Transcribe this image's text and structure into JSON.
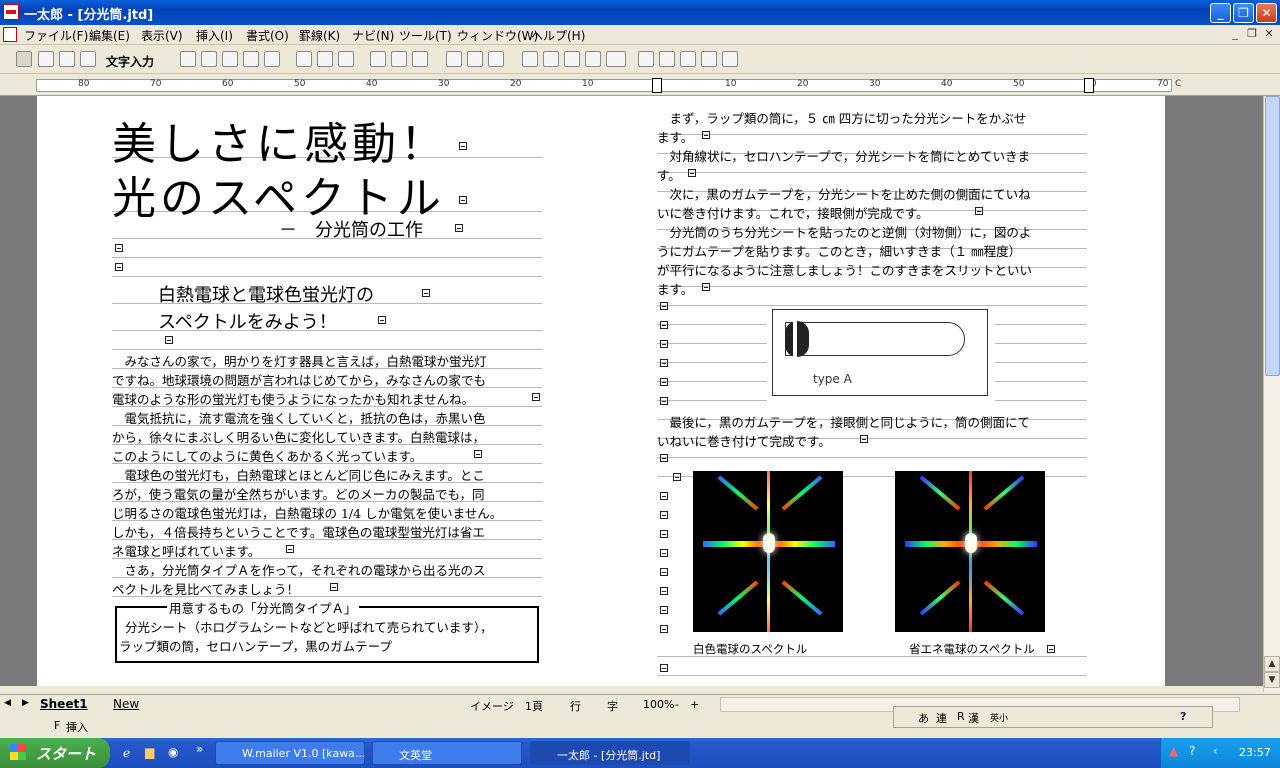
{
  "window": {
    "title": "一太郎 - [分光筒.jtd]"
  },
  "menu": {
    "items": [
      "ファイル(F)",
      "編集(E)",
      "表示(V)",
      "挿入(I)",
      "書式(O)",
      "罫線(K)",
      "ナビ(N)",
      "ツール(T)",
      "ウィンドウ(W)",
      "ヘルプ(H)"
    ]
  },
  "toolbar": {
    "mode_label": "文字入力"
  },
  "ruler": {
    "left_numbers": [
      "80",
      "70",
      "60",
      "50",
      "40",
      "30",
      "20",
      "10"
    ],
    "right_numbers": [
      "10",
      "20",
      "30",
      "40",
      "50",
      "60",
      "70"
    ],
    "end_marker": "C"
  },
  "doc": {
    "title1": "美しさに感動！",
    "title2": "光のスペクトル",
    "subtitle": "－　分光筒の工作",
    "heading1": "白熱電球と電球色蛍光灯の",
    "heading2": "スペクトルをみよう！",
    "left_lines": [
      "　みなさんの家で，明かりを灯す器具と言えば，白熱電球か蛍光灯",
      "ですね。地球環境の問題が言われはじめてから，みなさんの家でも",
      "電球のような形の蛍光灯も使うようになったかも知れませんね。",
      "　電気抵抗に，流す電流を強くしていくと，抵抗の色は，赤黒い色",
      "から，徐々にまぶしく明るい色に変化していきます。白熱電球は，",
      "このようにしてのように黄色くあかるく光っています。",
      "　電球色の蛍光灯も，白熱電球とほとんど同じ色にみえます。とこ",
      "ろが，使う電気の量が全然ちがいます。どのメーカの製品でも，同",
      "じ明るさの電球色蛍光灯は，白熱電球の 1/4 しか電気を使いません。",
      "しかも，４倍長持ちということです。電球色の電球型蛍光灯は省エ",
      "ネ電球と呼ばれています。",
      "　さあ，分光筒タイプＡを作って，それぞれの電球から出る光のス",
      "ペクトルを見比べてみましょう！"
    ],
    "box_title": "用意するもの「分光筒タイプＡ」",
    "box_line1": "分光シート（ホログラムシートなどと呼ばれて売られています），",
    "box_line2": "ラップ類の筒，セロハンテープ，黒のガムテープ",
    "right_lines": [
      "　まず，ラップ類の筒に，５ ㎝ 四方に切った分光シートをかぶせ",
      "ます。",
      "　対角線状に，セロハンテープで，分光シートを筒にとめていきま",
      "す。",
      "　次に，黒のガムテープを，分光シートを止めた側の側面にていね",
      "いに巻き付けます。これで，接眼側が完成です。",
      "　分光筒のうち分光シートを貼ったのと逆側（対物側）に，図のよ",
      "うにガムテープを貼ります。このとき，細いすきま（１ ㎜程度）",
      "が平行になるように注意しましょう！このすきまをスリットといい",
      "ます。"
    ],
    "diagram_label": "type A",
    "right_lines2": [
      "　最後に，黒のガムテープを，接眼側と同じように，筒の側面にて",
      "いねいに巻き付けて完成です。"
    ],
    "caption_left": "白色電球のスペクトル",
    "caption_right": "省エネ電球のスペクトル"
  },
  "sheetbar": {
    "sheet1": "Sheet1",
    "new": "New",
    "image_label": "イメージ",
    "page": "1頁",
    "row": "行",
    "col": "字",
    "zoom": "100%",
    "minus": "-",
    "plus": "+"
  },
  "status": {
    "mode": "F",
    "insert": "挿入"
  },
  "ime": {
    "items": [
      "あ",
      "連",
      "R",
      "漢",
      "英小"
    ]
  },
  "taskbar": {
    "start": "スタート",
    "tasks": [
      "W.mailer  V1.0 [kawa...",
      "文英堂",
      "一太郎 - [分光筒.jtd]"
    ],
    "clock": "23:57",
    "chevron": "»"
  }
}
